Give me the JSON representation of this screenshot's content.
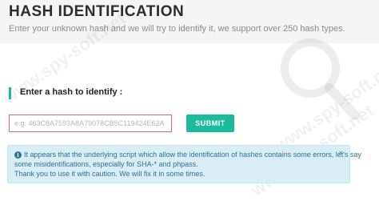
{
  "header": {
    "title": "HASH IDENTIFICATION",
    "subtitle": "Enter your unknown hash and we will try to identify it, we support over 250 hash types."
  },
  "watermark_text": "www.spy-soft.net",
  "form": {
    "label": "Enter a hash to identify :",
    "input_placeholder": "e.g. 463C8A7593A8A79078CB5C119424E62A",
    "input_value": "",
    "submit_label": "SUBMIT"
  },
  "alert": {
    "line1": "It appears that the underlying script which allow the identification of hashes contains some errors, let's say",
    "line2": "some misidentifications, especially for SHA-* and phpass.",
    "line3": "Thank you to use it with caution. We will fix it in some times.",
    "close_symbol": "×",
    "info_symbol": "i"
  },
  "colors": {
    "accent": "#1abc9c",
    "input_border": "#e06a6a",
    "alert_bg": "#d9edf7",
    "alert_text": "#31708f"
  }
}
